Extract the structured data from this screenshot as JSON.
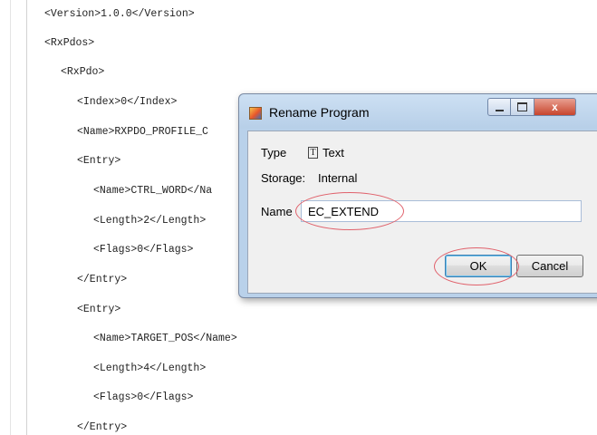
{
  "code_lines": [
    {
      "text": "<Version>1.0.0</Version>"
    },
    {
      "text": "<RxPdos>"
    },
    {
      "text": "<RxPdo>"
    },
    {
      "text": "<Index>0</Index>"
    },
    {
      "text": "<Name>RXPDO_PROFILE_C"
    },
    {
      "text": "<Entry>"
    },
    {
      "text": "<Name>CTRL_WORD</Na"
    },
    {
      "text": "<Length>2</Length>"
    },
    {
      "text": "<Flags>0</Flags>"
    },
    {
      "text": "</Entry>"
    },
    {
      "text": "<Entry>"
    },
    {
      "text": "<Name>TARGET_POS</Name>"
    },
    {
      "text": "<Length>4</Length>"
    },
    {
      "text": "<Flags>0</Flags>"
    },
    {
      "text": "</Entry>"
    }
  ],
  "dialog": {
    "title": "Rename Program",
    "type_label": "Type",
    "type_icon": "text-file-icon",
    "type_value": "Text",
    "storage_label": "Storage:",
    "storage_value": "Internal",
    "name_label": "Name",
    "name_value": "EC_EXTEND",
    "ok_label": "OK",
    "cancel_label": "Cancel",
    "close_glyph": "x"
  },
  "colors": {
    "annotation": "#e0616b",
    "titlebar": "#b9d1ea",
    "close_button": "#c7452d"
  }
}
